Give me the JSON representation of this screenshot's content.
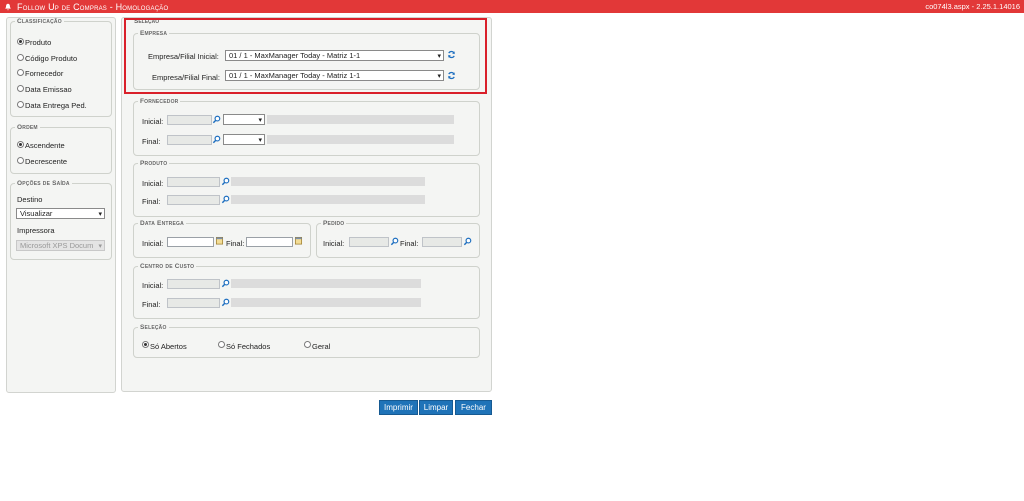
{
  "header": {
    "title": "Follow Up de Compras  - Homologação",
    "version": "co074l3.aspx - 2.25.1.14016"
  },
  "sidebar": {
    "classificacao": {
      "legend": "Classificação",
      "options": [
        "Produto",
        "Código Produto",
        "Fornecedor",
        "Data Emissao",
        "Data Entrega Ped."
      ],
      "selected": "Produto"
    },
    "ordem": {
      "legend": "Ordem",
      "options": [
        "Ascendente",
        "Decrescente"
      ],
      "selected": "Ascendente"
    },
    "opcoes": {
      "legend": "Opções de Saída",
      "destino_label": "Destino",
      "destino_value": "Visualizar",
      "impressora_label": "Impressora",
      "impressora_value": "Microsoft XPS Docum"
    }
  },
  "main": {
    "legend": "Seleção",
    "empresa": {
      "legend": "Empresa",
      "inicial_label": "Empresa/Filial Inicial:",
      "inicial_value": "01 / 1 - MaxManager Today - Matriz 1-1",
      "final_label": "Empresa/Filial Final:",
      "final_value": "01 / 1 - MaxManager Today - Matriz 1-1"
    },
    "fornecedor": {
      "legend": "Fornecedor",
      "inicial_label": "Inicial:",
      "final_label": "Final:"
    },
    "produto": {
      "legend": "Produto",
      "inicial_label": "Inicial:",
      "final_label": "Final:"
    },
    "data_entrega": {
      "legend": "Data Entrega",
      "inicial_label": "Inicial:",
      "final_label": "Final:"
    },
    "pedido": {
      "legend": "Pedido",
      "inicial_label": "Inicial:",
      "final_label": "Final:"
    },
    "centro_custo": {
      "legend": "Centro de Custo",
      "inicial_label": "Inicial:",
      "final_label": "Final:"
    },
    "selecao": {
      "legend": "Seleção",
      "options": [
        "Só Abertos",
        "Só Fechados",
        "Geral"
      ],
      "selected": "Só Abertos"
    }
  },
  "buttons": {
    "imprimir": "Imprimir",
    "limpar": "Limpar",
    "fechar": "Fechar"
  },
  "colors": {
    "titlebar": "#e23838",
    "button": "#1f73b8",
    "highlight": "#d9202a"
  }
}
